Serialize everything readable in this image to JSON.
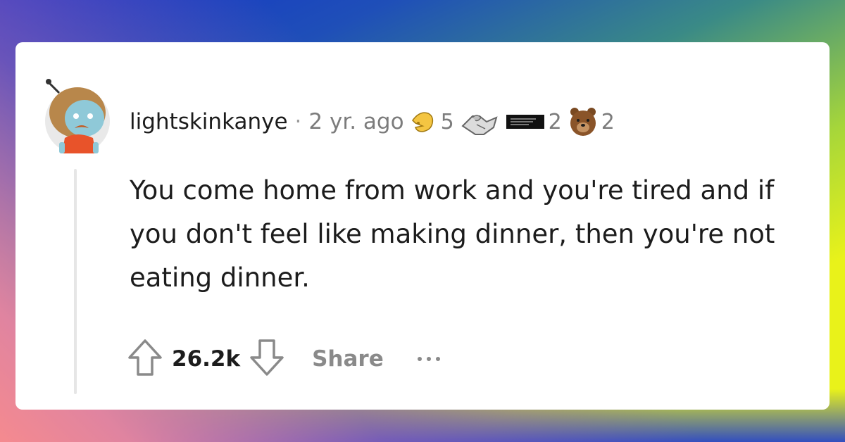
{
  "comment": {
    "username": "lightskinkanye",
    "separator": "·",
    "timestamp": "2 yr. ago",
    "awards": [
      {
        "icon": "pointing-hand-award-icon",
        "count": "5"
      },
      {
        "icon": "handshake-award-icon",
        "count": ""
      },
      {
        "icon": "text-card-award-icon",
        "count": "2"
      },
      {
        "icon": "bear-award-icon",
        "count": "2"
      }
    ],
    "body": "You come home from work and you're tired and if you don't feel like making dinner, then you're not eating dinner."
  },
  "actions": {
    "score": "26.2k",
    "share_label": "Share",
    "upvote_icon": "upvote-arrow-icon",
    "downvote_icon": "downvote-arrow-icon",
    "more_icon": "ellipsis-icon"
  },
  "colors": {
    "text_primary": "#1c1c1c",
    "text_muted": "#7c7c7c",
    "card_bg": "#ffffff"
  }
}
